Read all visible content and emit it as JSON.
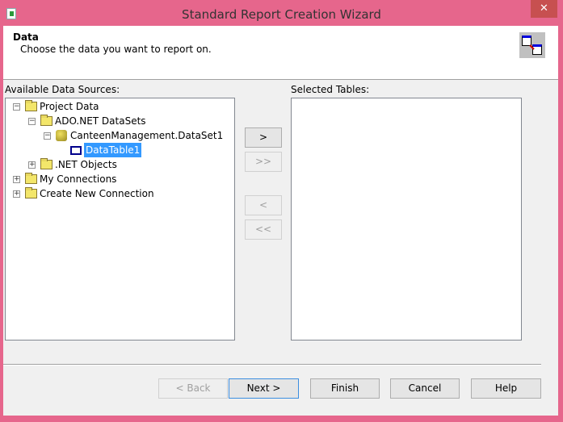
{
  "window": {
    "title": "Standard Report Creation Wizard",
    "close_glyph": "✕"
  },
  "header": {
    "title": "Data",
    "subtitle": "Choose the data you want to report on."
  },
  "available": {
    "label": "Available Data Sources:",
    "items": [
      {
        "label": "Project Data",
        "expander": "−"
      },
      {
        "label": "ADO.NET DataSets",
        "expander": "−"
      },
      {
        "label": "CanteenManagement.DataSet1",
        "expander": "−"
      },
      {
        "label": "DataTable1",
        "selected": true
      },
      {
        "label": ".NET Objects",
        "expander": "+"
      },
      {
        "label": "My Connections",
        "expander": "+"
      },
      {
        "label": "Create New Connection",
        "expander": "+"
      }
    ]
  },
  "selected": {
    "label": "Selected Tables:"
  },
  "transfer": {
    "add": ">",
    "add_all": ">>",
    "remove": "<",
    "remove_all": "<<"
  },
  "footer": {
    "back": "< Back",
    "next": "Next >",
    "finish": "Finish",
    "cancel": "Cancel",
    "help": "Help"
  }
}
